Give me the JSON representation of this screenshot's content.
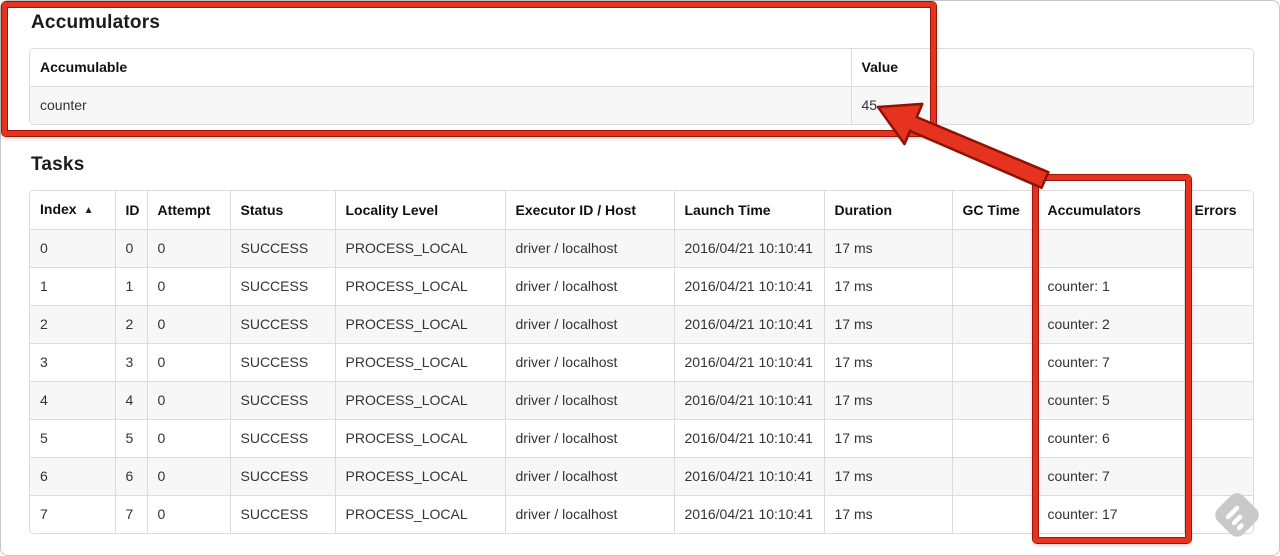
{
  "page": {
    "accumulators_title": "Accumulators",
    "tasks_title": "Tasks"
  },
  "accumulators_table": {
    "headers": [
      "Accumulable",
      "Value"
    ],
    "rows": [
      [
        "counter",
        "45"
      ]
    ]
  },
  "tasks_table": {
    "sort_indicator": "▲",
    "sorted_column": "Index",
    "headers": [
      "Index",
      "ID",
      "Attempt",
      "Status",
      "Locality Level",
      "Executor ID / Host",
      "Launch Time",
      "Duration",
      "GC Time",
      "Accumulators",
      "Errors"
    ],
    "rows": [
      [
        "0",
        "0",
        "0",
        "SUCCESS",
        "PROCESS_LOCAL",
        "driver / localhost",
        "2016/04/21 10:10:41",
        "17 ms",
        "",
        "",
        ""
      ],
      [
        "1",
        "1",
        "0",
        "SUCCESS",
        "PROCESS_LOCAL",
        "driver / localhost",
        "2016/04/21 10:10:41",
        "17 ms",
        "",
        "counter: 1",
        ""
      ],
      [
        "2",
        "2",
        "0",
        "SUCCESS",
        "PROCESS_LOCAL",
        "driver / localhost",
        "2016/04/21 10:10:41",
        "17 ms",
        "",
        "counter: 2",
        ""
      ],
      [
        "3",
        "3",
        "0",
        "SUCCESS",
        "PROCESS_LOCAL",
        "driver / localhost",
        "2016/04/21 10:10:41",
        "17 ms",
        "",
        "counter: 7",
        ""
      ],
      [
        "4",
        "4",
        "0",
        "SUCCESS",
        "PROCESS_LOCAL",
        "driver / localhost",
        "2016/04/21 10:10:41",
        "17 ms",
        "",
        "counter: 5",
        ""
      ],
      [
        "5",
        "5",
        "0",
        "SUCCESS",
        "PROCESS_LOCAL",
        "driver / localhost",
        "2016/04/21 10:10:41",
        "17 ms",
        "",
        "counter: 6",
        ""
      ],
      [
        "6",
        "6",
        "0",
        "SUCCESS",
        "PROCESS_LOCAL",
        "driver / localhost",
        "2016/04/21 10:10:41",
        "17 ms",
        "",
        "counter: 7",
        ""
      ],
      [
        "7",
        "7",
        "0",
        "SUCCESS",
        "PROCESS_LOCAL",
        "driver / localhost",
        "2016/04/21 10:10:41",
        "17 ms",
        "",
        "counter: 17",
        ""
      ]
    ]
  },
  "annotations": {
    "highlight_color": "#e5331f",
    "highlighted_value": "45",
    "watermark_icon": "feedly-logo"
  }
}
